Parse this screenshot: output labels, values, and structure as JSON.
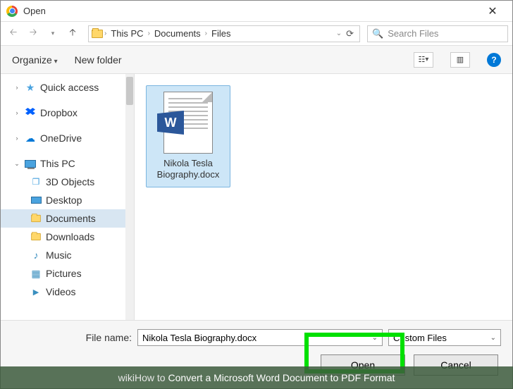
{
  "window": {
    "title": "Open"
  },
  "breadcrumb": {
    "this_pc": "This PC",
    "documents": "Documents",
    "files": "Files"
  },
  "search": {
    "placeholder": "Search Files"
  },
  "cmdbar": {
    "organize": "Organize",
    "new_folder": "New folder"
  },
  "sidebar": {
    "quick_access": "Quick access",
    "dropbox": "Dropbox",
    "onedrive": "OneDrive",
    "this_pc": "This PC",
    "children": {
      "threed": "3D Objects",
      "desktop": "Desktop",
      "documents": "Documents",
      "downloads": "Downloads",
      "music": "Music",
      "pictures": "Pictures",
      "videos": "Videos"
    }
  },
  "file": {
    "name": "Nikola Tesla Biography.docx",
    "badge": "W"
  },
  "footer": {
    "filename_label": "File name:",
    "filename_value": "Nikola Tesla Biography.docx",
    "filetype": "Custom Files",
    "open": "Open",
    "cancel": "Cancel"
  },
  "banner": {
    "prefix": "wikiHow to",
    "text": " Convert a Microsoft Word Document to PDF Format"
  }
}
